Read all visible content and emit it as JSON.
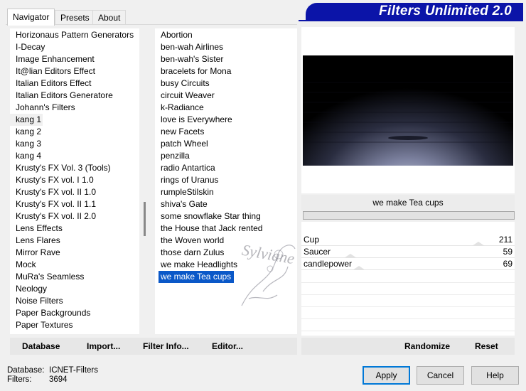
{
  "tabs": [
    {
      "label": "Navigator"
    },
    {
      "label": "Presets"
    },
    {
      "label": "About"
    }
  ],
  "banner_title": "Filters Unlimited 2.0",
  "categories": [
    "Horizonaus Pattern Generators",
    "I-Decay",
    "Image Enhancement",
    "It@lian Editors Effect",
    "Italian Editors Effect",
    "Italian Editors Generatore",
    "Johann's Filters",
    "kang 1",
    "kang 2",
    "kang 3",
    "kang 4",
    "Krusty's FX Vol. 3 (Tools)",
    "Krusty's FX vol. I 1.0",
    "Krusty's FX vol. II 1.0",
    "Krusty's FX vol. II 1.1",
    "Krusty's FX vol. II 2.0",
    "Lens Effects",
    "Lens Flares",
    "Mirror Rave",
    "Mock",
    "MuRa's Seamless",
    "Neology",
    "Noise Filters",
    "Paper Backgrounds",
    "Paper Textures"
  ],
  "selected_category": "kang 1",
  "filters": [
    "Abortion",
    "ben-wah Airlines",
    "ben-wah's Sister",
    "bracelets for Mona",
    "busy Circuits",
    "circuit Weaver",
    "k-Radiance",
    "love is Everywhere",
    "new Facets",
    "patch Wheel",
    "penzilla",
    "radio Antartica",
    "rings of Uranus",
    "rumpleStilskin",
    "shiva's Gate",
    "some snowflake Star thing",
    "the House that Jack rented",
    "the Woven world",
    "those darn Zulus",
    "we make Headlights",
    "we make Tea cups"
  ],
  "selected_filter": "we make Tea cups",
  "filter_title": "we make Tea cups",
  "params": [
    {
      "label": "Cup",
      "value": "211"
    },
    {
      "label": "Saucer",
      "value": "59"
    },
    {
      "label": "candlepower",
      "value": "69"
    }
  ],
  "param_levels": [
    0.83,
    0.23,
    0.27
  ],
  "watermark": "Sylviane",
  "bottom_buttons": {
    "database": "Database",
    "import": "Import...",
    "filter_info": "Filter Info...",
    "editor": "Editor...",
    "randomize": "Randomize",
    "reset": "Reset"
  },
  "status": {
    "database_label": "Database:",
    "database_value": "ICNET-Filters",
    "filters_label": "Filters:",
    "filters_value": "3694"
  },
  "dialog_buttons": {
    "apply": "Apply",
    "cancel": "Cancel",
    "help": "Help"
  },
  "colors": {
    "banner": "#0b14a8",
    "selection": "#0a58c8"
  }
}
